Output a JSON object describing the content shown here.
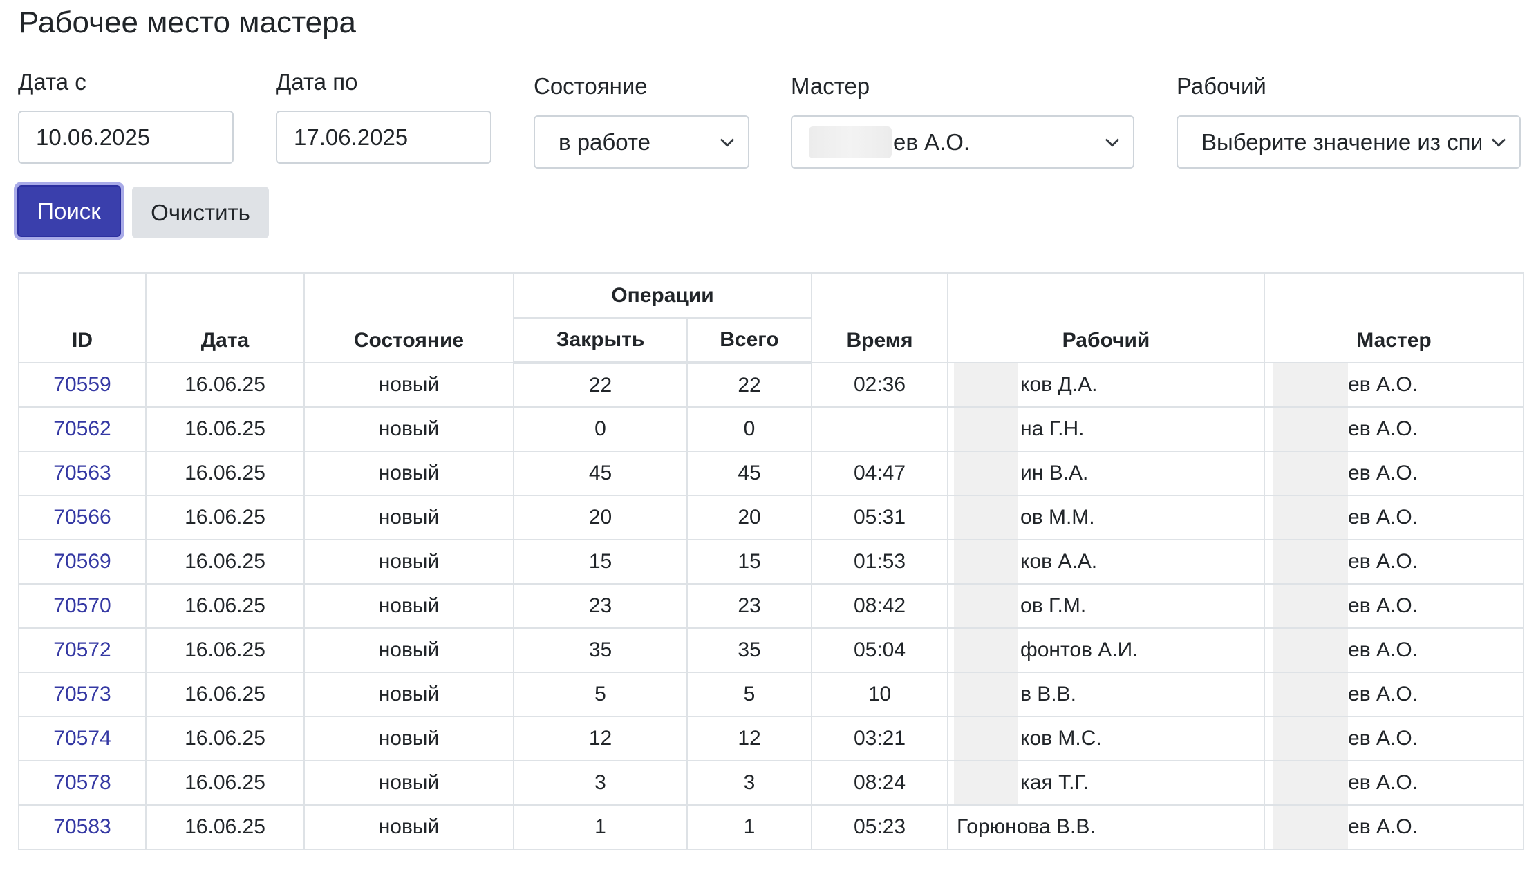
{
  "page": {
    "title": "Рабочее место мастера"
  },
  "filters": {
    "date_from": {
      "label": "Дата с",
      "value": "10.06.2025"
    },
    "date_to": {
      "label": "Дата по",
      "value": "17.06.2025"
    },
    "state": {
      "label": "Состояние",
      "value": "в работе"
    },
    "master": {
      "label": "Мастер",
      "value": "ев А.О."
    },
    "worker": {
      "label": "Рабочий",
      "value": "Выберите значение из спи"
    }
  },
  "buttons": {
    "search": "Поиск",
    "clear": "Очистить"
  },
  "table": {
    "headers": {
      "id": "ID",
      "date": "Дата",
      "state": "Состояние",
      "operations": "Операции",
      "close": "Закрыть",
      "total": "Всего",
      "time": "Время",
      "worker": "Рабочий",
      "master": "Мастер"
    },
    "rows": [
      {
        "id": "70559",
        "date": "16.06.25",
        "state": "новый",
        "close": "22",
        "total": "22",
        "time": "02:36",
        "worker": "ков Д.А.",
        "master": "ев А.О."
      },
      {
        "id": "70562",
        "date": "16.06.25",
        "state": "новый",
        "close": "0",
        "total": "0",
        "time": "",
        "worker": "на Г.Н.",
        "master": "ев А.О."
      },
      {
        "id": "70563",
        "date": "16.06.25",
        "state": "новый",
        "close": "45",
        "total": "45",
        "time": "04:47",
        "worker": "ин В.А.",
        "master": "ев А.О."
      },
      {
        "id": "70566",
        "date": "16.06.25",
        "state": "новый",
        "close": "20",
        "total": "20",
        "time": "05:31",
        "worker": "ов М.М.",
        "master": "ев А.О."
      },
      {
        "id": "70569",
        "date": "16.06.25",
        "state": "новый",
        "close": "15",
        "total": "15",
        "time": "01:53",
        "worker": "ков А.А.",
        "master": "ев А.О."
      },
      {
        "id": "70570",
        "date": "16.06.25",
        "state": "новый",
        "close": "23",
        "total": "23",
        "time": "08:42",
        "worker": "ов Г.М.",
        "master": "ев А.О."
      },
      {
        "id": "70572",
        "date": "16.06.25",
        "state": "новый",
        "close": "35",
        "total": "35",
        "time": "05:04",
        "worker": "фонтов А.И.",
        "master": "ев А.О."
      },
      {
        "id": "70573",
        "date": "16.06.25",
        "state": "новый",
        "close": "5",
        "total": "5",
        "time": "10",
        "worker": "в В.В.",
        "master": "ев А.О."
      },
      {
        "id": "70574",
        "date": "16.06.25",
        "state": "новый",
        "close": "12",
        "total": "12",
        "time": "03:21",
        "worker": "ков М.С.",
        "master": "ев А.О."
      },
      {
        "id": "70578",
        "date": "16.06.25",
        "state": "новый",
        "close": "3",
        "total": "3",
        "time": "08:24",
        "worker": "кая Т.Г.",
        "master": "ев А.О."
      },
      {
        "id": "70583",
        "date": "16.06.25",
        "state": "новый",
        "close": "1",
        "total": "1",
        "time": "05:23",
        "worker": "Горюнова В.В.",
        "master": "ев А.О."
      }
    ]
  }
}
